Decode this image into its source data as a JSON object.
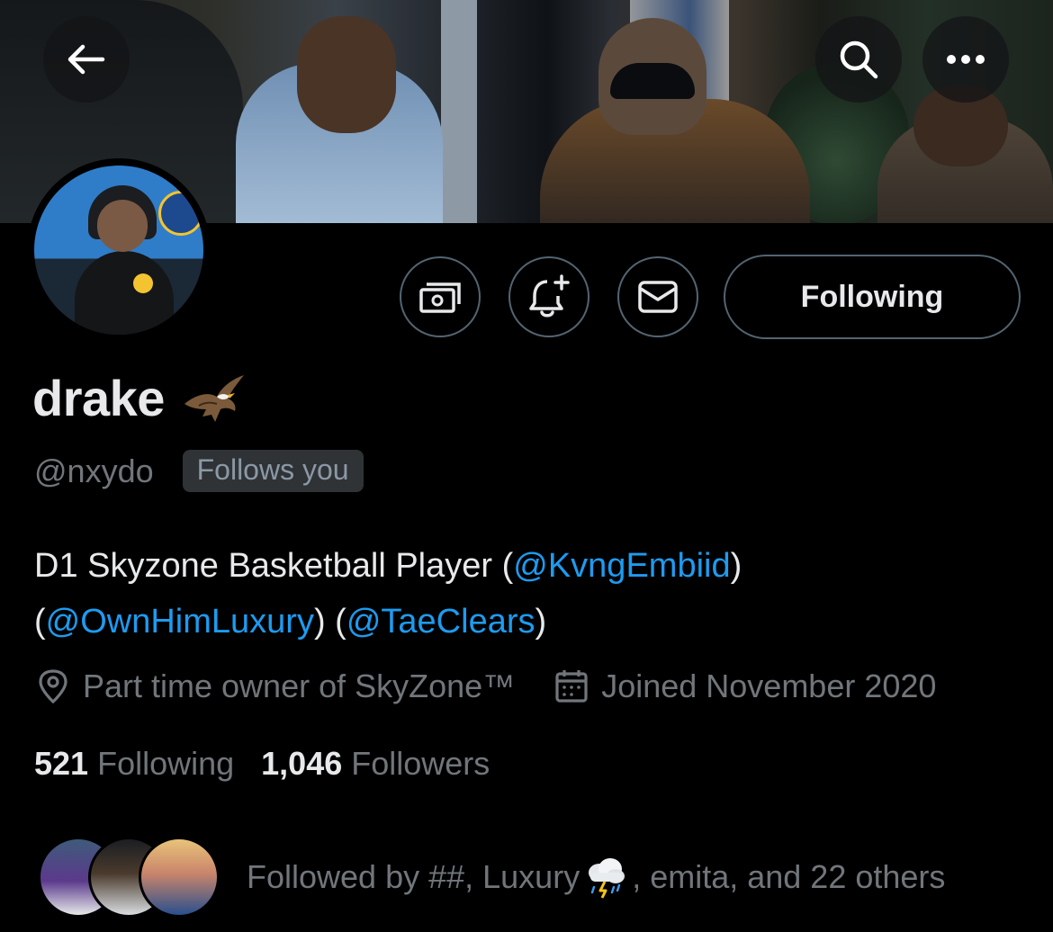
{
  "header": {
    "back_label": "Back",
    "search_label": "Search",
    "more_label": "More"
  },
  "profile": {
    "display_name": "drake",
    "name_emoji": "eagle-emoji",
    "handle": "@nxydo",
    "follows_you": "Follows you",
    "bio": {
      "text1": "D1 Skyzone Basketball Player (",
      "mention1": "@KvngEmbiid",
      "text2": ")",
      "text3": "(",
      "mention2": "@OwnHimLuxury",
      "text4": ") (",
      "mention3": "@TaeClears",
      "text5": ")"
    },
    "location": "Part time owner of SkyZone™",
    "joined": "Joined November 2020"
  },
  "actions": {
    "tip_icon": "money-icon",
    "notify_icon": "bell-plus-icon",
    "message_icon": "envelope-icon",
    "following_label": "Following"
  },
  "stats": {
    "following_count": "521",
    "following_label": "Following",
    "followers_count": "1,046",
    "followers_label": "Followers"
  },
  "followed_by": {
    "prefix": "Followed by ##, Luxury",
    "suffix": ", emita, and 22 others",
    "emoji": "cloud-with-lightning-and-rain"
  },
  "colors": {
    "background": "#000000",
    "text_primary": "#e7e9ea",
    "text_secondary": "#71767b",
    "accent": "#1d9bf0",
    "border": "#536471"
  }
}
